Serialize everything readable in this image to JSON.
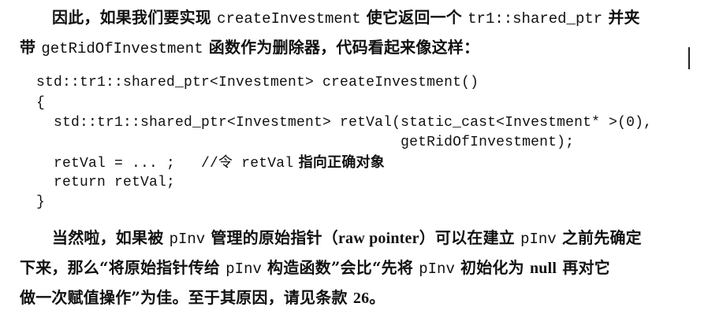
{
  "paragraph1": {
    "line1": {
      "pre": "因此，如果我们要实现 ",
      "code1": "createInvestment",
      "mid": " 使它返回一个 ",
      "code2": "tr1::shared_ptr",
      "post": " 并夹"
    },
    "line2": {
      "pre": "带 ",
      "code1": "getRidOfInvestment",
      "post": " 函数作为删除器，代码看起来像这样："
    }
  },
  "code_block": {
    "l1": "std::tr1::shared_ptr<Investment> createInvestment()",
    "l2": "{",
    "l3": "  std::tr1::shared_ptr<Investment> retVal(static_cast<Investment* >(0),",
    "l4": "                                          getRidOfInvestment);",
    "l5_code": "  retVal = ... ;   //令 ",
    "l5_code2": "retVal",
    "l5_cn": " 指向正确对象",
    "l6": "  return retVal;",
    "l7": "}"
  },
  "paragraph2": {
    "line1": {
      "pre": "当然啦，如果被 ",
      "code1": "pInv",
      "mid1": " 管理的原始指针（",
      "roman1": "raw pointer",
      "mid2": "）可以在建立 ",
      "code2": "pInv",
      "post": " 之前先确定"
    },
    "line2": {
      "pre": "下来，那么“将原始指针传给 ",
      "code1": "pInv",
      "mid": " 构造函数”会比“先将 ",
      "code2": "pInv",
      "mid2": " 初始化为 ",
      "roman1": "null",
      "post": " 再对它"
    },
    "line3": {
      "pre": "做一次赋值操作”为佳。至于其原因，请见条款 ",
      "roman1": "26",
      "post": "。"
    }
  }
}
